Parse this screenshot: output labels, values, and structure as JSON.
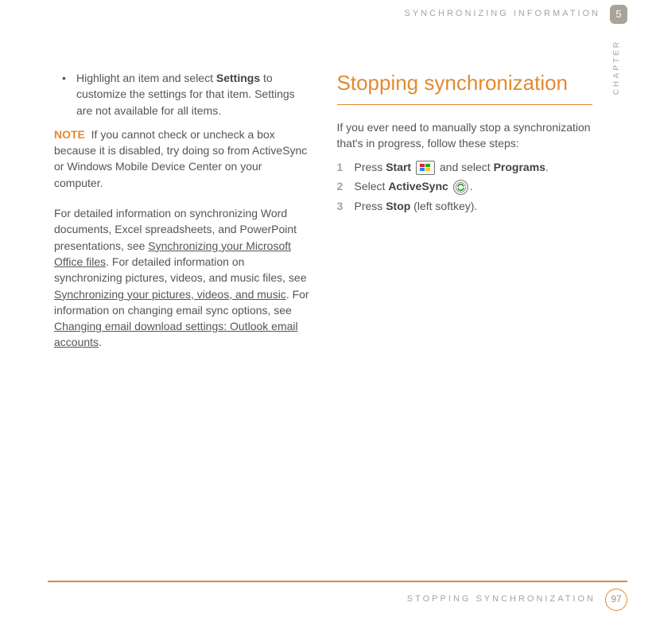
{
  "header": {
    "running_title": "SYNCHRONIZING INFORMATION",
    "chapter_number": "5",
    "chapter_label": "CHAPTER"
  },
  "left": {
    "bullet_pre": "Highlight an item and select ",
    "bullet_bold": "Settings",
    "bullet_post": " to customize the settings for that item. Settings are not available for all items.",
    "note_label": "NOTE",
    "note_body": "If you cannot check or uncheck a box because it is disabled, try doing so from ActiveSync or Windows Mobile Device Center on your computer.",
    "para2_pre": "For detailed information on synchronizing Word documents, Excel spreadsheets, and PowerPoint presentations, see ",
    "link1": "Synchronizing your Microsoft Office files",
    "para2_mid": ". For detailed information on synchronizing pictures, videos, and music files, see ",
    "link2": "Synchronizing your pictures, videos, and music",
    "para2_mid2": ". For information on changing email sync options, see ",
    "link3": "Changing email download settings: Outlook email accounts",
    "para2_end": "."
  },
  "right": {
    "heading": "Stopping synchronization",
    "intro": "If you ever need to manually stop a synchronization that's in progress, follow these steps:",
    "step1_a": "Press ",
    "step1_b": "Start",
    "step1_c": " and select ",
    "step1_d": "Programs",
    "step1_e": ".",
    "step2_a": "Select ",
    "step2_b": "ActiveSync",
    "step2_c": ".",
    "step3_a": "Press ",
    "step3_b": "Stop",
    "step3_c": " (left softkey)."
  },
  "footer": {
    "title": "STOPPING SYNCHRONIZATION",
    "page": "97"
  }
}
